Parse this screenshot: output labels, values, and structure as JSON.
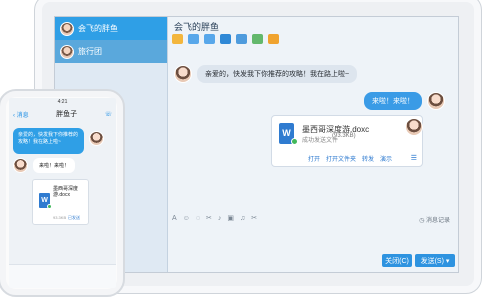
{
  "desktop": {
    "sidebar": {
      "items": [
        {
          "label": "会飞的胖鱼"
        },
        {
          "label": "旅行团"
        }
      ]
    },
    "chat": {
      "title": "会飞的胖鱼",
      "messages": [
        {
          "from": "other",
          "text": "亲爱的，快发我下你推荐的攻略！我在路上啦~"
        },
        {
          "from": "me",
          "text": "来啦！来啦！"
        }
      ],
      "file": {
        "icon": "W",
        "name": "墨西哥深度游.doxc",
        "size": "(93.3KB)",
        "status": "成功发送文件",
        "actions": [
          "打开",
          "打开文件夹",
          "转发",
          "演示"
        ]
      },
      "history_label": "消息记录",
      "buttons": {
        "close": "关闭(C)",
        "send": "发送(S)"
      }
    }
  },
  "phone": {
    "status_time": "4:21",
    "back_label": "消息",
    "title": "胖鱼子",
    "message_in": "亲爱的，快发我下你推荐的攻略！我在路上啦~",
    "message_out": "来啦！来啦！",
    "file": {
      "icon": "W",
      "name": "墨西哥深度游.docx",
      "size": "93.3KB",
      "status": "已发送"
    }
  },
  "icons": {
    "file": "word-file-icon"
  }
}
